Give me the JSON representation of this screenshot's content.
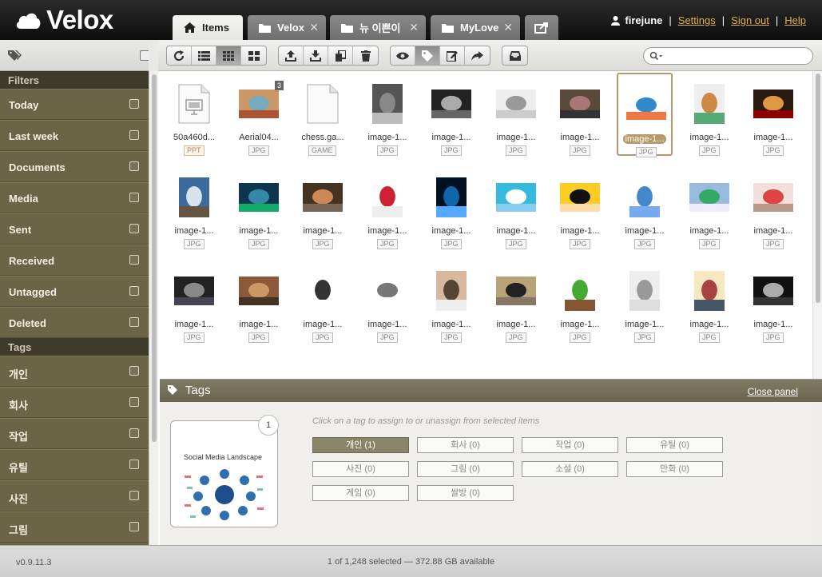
{
  "app": {
    "name": "Velox",
    "version": "v0.9.11.3"
  },
  "tabs": [
    {
      "label": "Items",
      "icon": "home-icon",
      "active": true
    },
    {
      "label": "Velox",
      "icon": "folder-icon",
      "active": false
    },
    {
      "label": "뉴 이쁜이",
      "icon": "folder-icon",
      "active": false
    },
    {
      "label": "MyLove",
      "icon": "folder-icon",
      "active": false
    }
  ],
  "user": {
    "name": "firejune",
    "settings": "Settings",
    "signout": "Sign out",
    "help": "Help"
  },
  "sidebar": {
    "filters_title": "Filters",
    "filters": [
      "Today",
      "Last week",
      "Documents",
      "Media",
      "Sent",
      "Received",
      "Untagged",
      "Deleted"
    ],
    "tags_title": "Tags",
    "tags": [
      "개인",
      "회사",
      "작업",
      "유틸",
      "사진",
      "그림"
    ]
  },
  "toolbar": {
    "groups": [
      [
        "refresh-icon",
        "list-view-icon",
        "grid-view-icon",
        "large-grid-icon"
      ],
      [
        "upload-icon",
        "download-icon",
        "copy-icon",
        "trash-icon"
      ],
      [
        "eye-icon",
        "tag-icon",
        "edit-icon",
        "share-icon"
      ],
      [
        "inbox-icon"
      ]
    ],
    "search_placeholder": ""
  },
  "items": [
    {
      "name": "50a460d...",
      "type": "PPT"
    },
    {
      "name": "Aerial04...",
      "type": "JPG",
      "count": "3"
    },
    {
      "name": "chess.ga...",
      "type": "GAME"
    },
    {
      "name": "image-1...",
      "type": "JPG"
    },
    {
      "name": "image-1...",
      "type": "JPG"
    },
    {
      "name": "image-1...",
      "type": "JPG"
    },
    {
      "name": "image-1...",
      "type": "JPG"
    },
    {
      "name": "image-1...",
      "type": "JPG",
      "selected": true
    },
    {
      "name": "image-1...",
      "type": "JPG"
    },
    {
      "name": "image-1...",
      "type": "JPG"
    },
    {
      "name": "image-1...",
      "type": "JPG"
    },
    {
      "name": "image-1...",
      "type": "JPG"
    },
    {
      "name": "image-1...",
      "type": "JPG"
    },
    {
      "name": "image-1...",
      "type": "JPG"
    },
    {
      "name": "image-1...",
      "type": "JPG"
    },
    {
      "name": "image-1...",
      "type": "JPG"
    },
    {
      "name": "image-1...",
      "type": "JPG"
    },
    {
      "name": "image-1...",
      "type": "JPG"
    },
    {
      "name": "image-1...",
      "type": "JPG"
    },
    {
      "name": "image-1...",
      "type": "JPG"
    },
    {
      "name": "image-1...",
      "type": "JPG"
    },
    {
      "name": "image-1...",
      "type": "JPG"
    },
    {
      "name": "image-1...",
      "type": "JPG"
    },
    {
      "name": "image-1...",
      "type": "JPG"
    },
    {
      "name": "image-1...",
      "type": "JPG"
    },
    {
      "name": "image-1...",
      "type": "JPG"
    },
    {
      "name": "image-1...",
      "type": "JPG"
    },
    {
      "name": "image-1...",
      "type": "JPG"
    },
    {
      "name": "image-1...",
      "type": "JPG"
    },
    {
      "name": "image-1...",
      "type": "JPG"
    }
  ],
  "tag_panel": {
    "title": "Tags",
    "close": "Close panel",
    "hint": "Click on a tag to assign to or unassign from selected items",
    "selected_count": "1",
    "preview_title": "Social Media Landscape",
    "tags": [
      {
        "label": "개인 (1)",
        "active": true
      },
      {
        "label": "회사 (0)"
      },
      {
        "label": "작업 (0)"
      },
      {
        "label": "유틸 (0)"
      },
      {
        "label": "사진 (0)"
      },
      {
        "label": "그림 (0)"
      },
      {
        "label": "소설 (0)"
      },
      {
        "label": "만화 (0)"
      },
      {
        "label": "게임 (0)"
      },
      {
        "label": "쌀방 (0)"
      }
    ]
  },
  "status": {
    "text": "1 of 1,248 selected — 372.88 GB available"
  },
  "colors": {
    "accent": "#e3b04b",
    "sidebar": "#6c6446",
    "selection": "#b89a6a"
  }
}
